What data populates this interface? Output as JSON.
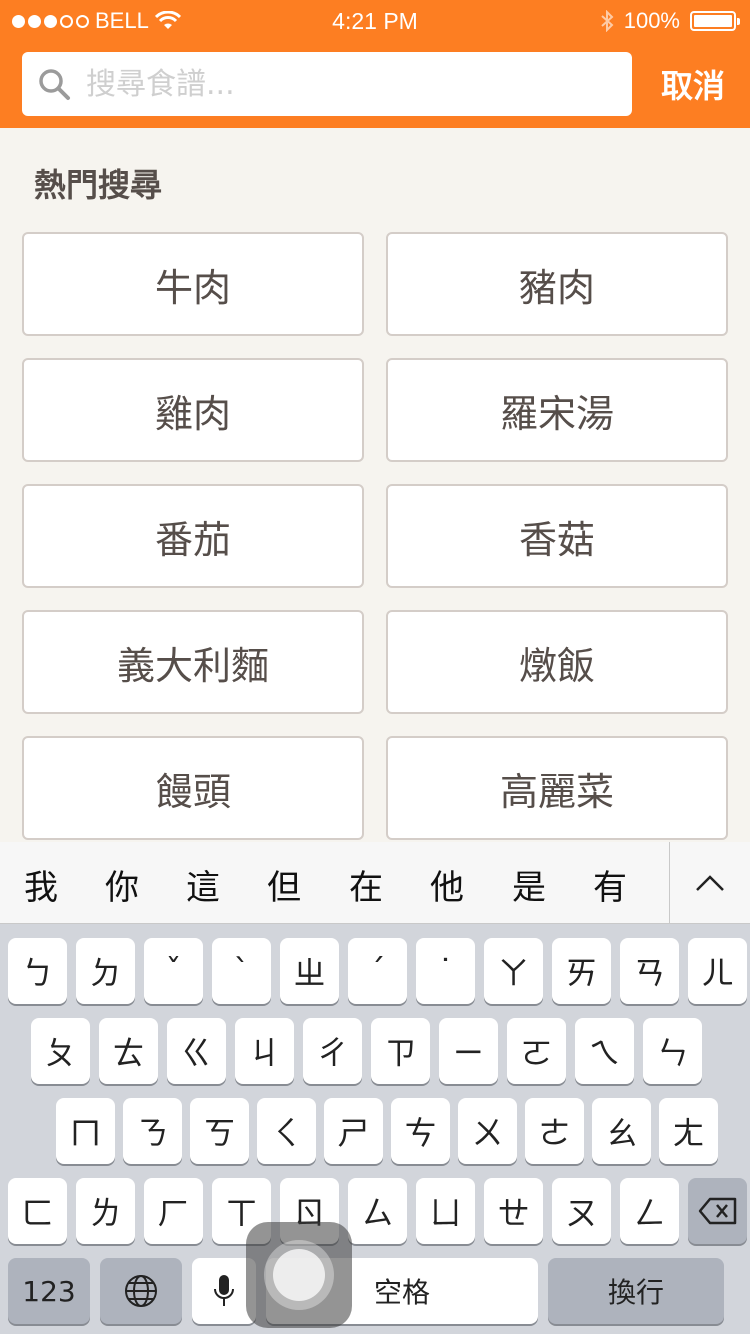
{
  "status": {
    "carrier": "BELL",
    "time": "4:21 PM",
    "battery": "100%"
  },
  "search": {
    "placeholder": "搜尋食譜...",
    "value": "",
    "cancel_label": "取消"
  },
  "hot": {
    "title": "熱門搜尋",
    "items": [
      "牛肉",
      "豬肉",
      "雞肉",
      "羅宋湯",
      "番茄",
      "香菇",
      "義大利麵",
      "燉飯",
      "饅頭",
      "高麗菜"
    ]
  },
  "keyboard": {
    "candidates": [
      "我",
      "你",
      "這",
      "但",
      "在",
      "他",
      "是",
      "有"
    ],
    "row1": [
      "ㄅ",
      "ㄉ",
      "ˇ",
      "ˋ",
      "ㄓ",
      "ˊ",
      "˙",
      "ㄚ",
      "ㄞ",
      "ㄢ",
      "ㄦ"
    ],
    "row2": [
      "ㄆ",
      "ㄊ",
      "ㄍ",
      "ㄐ",
      "ㄔ",
      "ㄗ",
      "ㄧ",
      "ㄛ",
      "ㄟ",
      "ㄣ"
    ],
    "row3": [
      "ㄇ",
      "ㄋ",
      "ㄎ",
      "ㄑ",
      "ㄕ",
      "ㄘ",
      "ㄨ",
      "ㄜ",
      "ㄠ",
      "ㄤ"
    ],
    "row4": [
      "ㄈ",
      "ㄌ",
      "ㄏ",
      "ㄒ",
      "ㄖ",
      "ㄙ",
      "ㄩ",
      "ㄝ",
      "ㄡ",
      "ㄥ"
    ],
    "numbers_label": "123",
    "space_label": "空格",
    "return_label": "換行"
  },
  "colors": {
    "accent": "#fd7e22",
    "text": "#564e4a",
    "border": "#d4cdc8",
    "background": "#f6f4ef",
    "placeholder": "#cfcfcf",
    "chip": "#ffffff"
  },
  "icons": [
    "search-icon",
    "wifi-icon",
    "bluetooth-icon",
    "battery-icon",
    "globe-icon",
    "microphone-icon",
    "delete-icon",
    "chevron-up-icon"
  ]
}
